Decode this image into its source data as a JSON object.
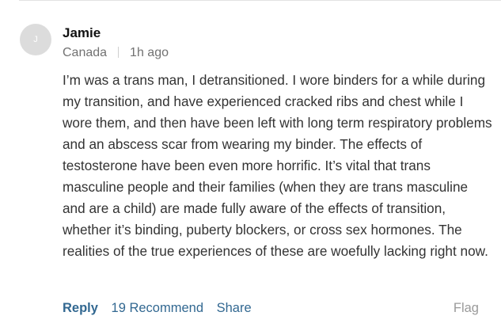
{
  "comment": {
    "avatar_initial": "J",
    "author": "Jamie",
    "location": "Canada",
    "time": "1h ago",
    "body": "I’m was a trans man, I detransitioned. I wore binders for a while during my transition, and have experienced cracked ribs and chest while I wore them, and then have been left with long term respiratory problems and an abscess scar from wearing my binder. The effects of testosterone have been even more horrific. It’s vital that trans masculine people and their families (when they are trans masculine and are a child) are made fully aware of the effects of transition, whether it’s binding, puberty blockers, or cross sex hormones. The realities of the true experiences of these are woefully lacking right now.",
    "actions": {
      "reply": "Reply",
      "recommend": "19 Recommend",
      "share": "Share",
      "flag": "Flag"
    }
  }
}
